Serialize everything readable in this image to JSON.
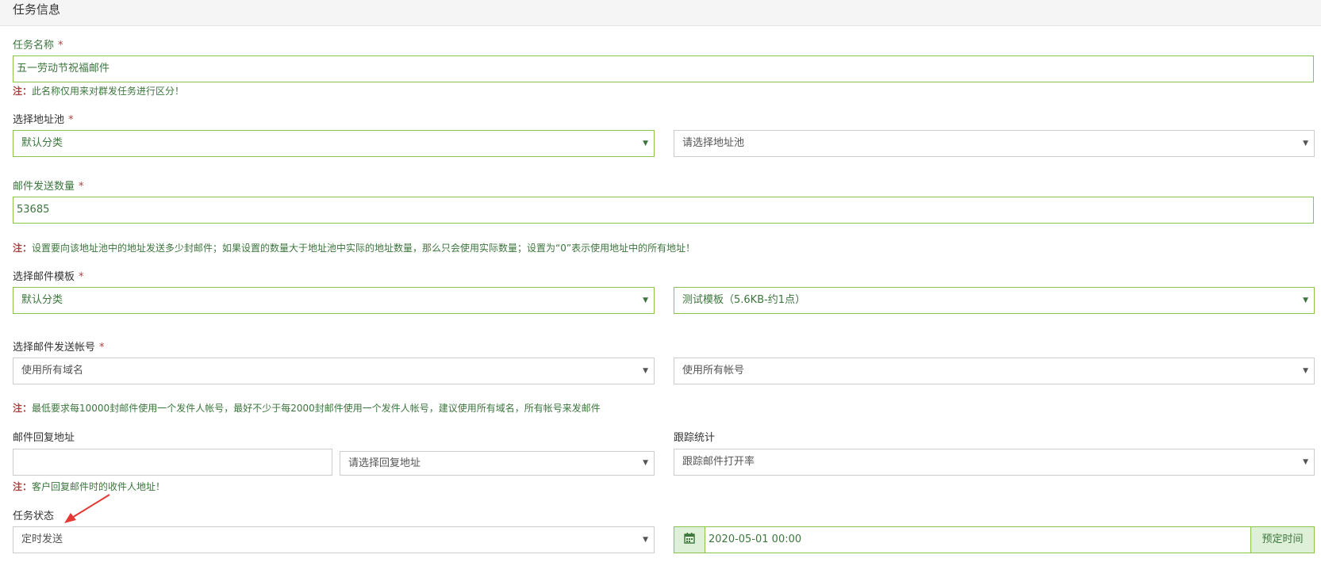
{
  "panel": {
    "title": "任务信息"
  },
  "task_name": {
    "label": "任务名称",
    "required": "*",
    "value": "五一劳动节祝福邮件",
    "note_prefix": "注：",
    "note": "此名称仅用来对群发任务进行区分！"
  },
  "address_pool": {
    "label": "选择地址池",
    "required": "*",
    "category": "默认分类",
    "pool": "请选择地址池"
  },
  "send_count": {
    "label": "邮件发送数量",
    "required": "*",
    "value": "53685",
    "note_prefix": "注：",
    "note": "设置要向该地址池中的地址发送多少封邮件；如果设置的数量大于地址池中实际的地址数量，那么只会使用实际数量；设置为“0”表示使用地址中的所有地址！"
  },
  "template": {
    "label": "选择邮件模板",
    "required": "*",
    "category": "默认分类",
    "template": "测试模板（5.6KB-约1点）"
  },
  "sender_account": {
    "label": "选择邮件发送帐号",
    "required": "*",
    "domain": "使用所有域名",
    "account": "使用所有帐号",
    "note_prefix": "注：",
    "note": "最低要求每10000封邮件使用一个发件人帐号，最好不少于每2000封邮件使用一个发件人帐号，建议使用所有域名，所有帐号来发邮件"
  },
  "reply_address": {
    "label": "邮件回复地址",
    "value": "",
    "select": "请选择回复地址",
    "note_prefix": "注：",
    "note": "客户回复邮件时的收件人地址！"
  },
  "tracking": {
    "label": "跟踪统计",
    "value": "跟踪邮件打开率"
  },
  "task_status": {
    "label": "任务状态",
    "value": "定时发送",
    "datetime": "2020-05-01 00:00",
    "schedule_button": "预定时间"
  },
  "icons": {
    "caret": "caret-down-icon",
    "calendar": "calendar-icon",
    "annotation": "red-arrow-icon"
  },
  "colors": {
    "success": "#3c763d",
    "success_border": "#8bc34a",
    "required": "#a94442",
    "addon_bg": "#dff0d8",
    "arrow": "#e53935"
  }
}
